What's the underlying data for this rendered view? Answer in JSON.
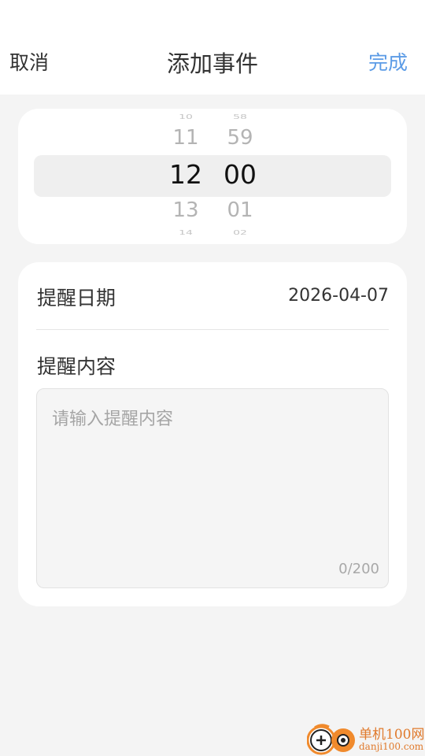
{
  "header": {
    "cancel_label": "取消",
    "title": "添加事件",
    "done_label": "完成",
    "done_color": "#5b9be6"
  },
  "time_picker": {
    "hours": {
      "far_above": "10",
      "above": "11",
      "selected": "12",
      "below": "13",
      "far_below": "14"
    },
    "minutes": {
      "far_above": "58",
      "above": "59",
      "selected": "00",
      "below": "01",
      "far_below": "02"
    }
  },
  "form": {
    "date_label": "提醒日期",
    "date_value": "2026-04-07",
    "content_label": "提醒内容",
    "content_placeholder": "请输入提醒内容",
    "content_value": "",
    "counter": "0/200"
  },
  "watermark": {
    "name": "单机100网",
    "url": "danji100.com"
  }
}
